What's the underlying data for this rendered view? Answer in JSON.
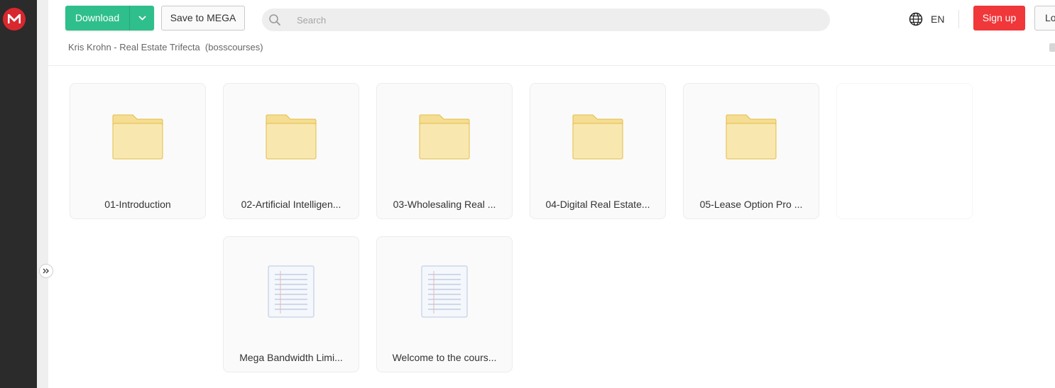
{
  "app": {
    "logo_icon": "mega-logo-icon",
    "accent": "#d9272e"
  },
  "toolbar": {
    "download_label": "Download",
    "save_label": "Save to MEGA",
    "download_color": "#2fbf8c"
  },
  "search": {
    "placeholder": "Search"
  },
  "language": {
    "label": "EN"
  },
  "auth": {
    "signup_label": "Sign up",
    "login_label": "Lo",
    "signup_color": "#f0373a"
  },
  "breadcrumb": {
    "folder": "Kris Krohn - Real Estate Trifecta",
    "owner": "(bosscourses)"
  },
  "items": [
    {
      "name": "01-Introduction",
      "type": "folder"
    },
    {
      "name": "02-Artificial Intelligen...",
      "type": "folder"
    },
    {
      "name": "03-Wholesaling Real ...",
      "type": "folder"
    },
    {
      "name": "04-Digital Real Estate...",
      "type": "folder"
    },
    {
      "name": "05-Lease Option Pro ...",
      "type": "folder"
    },
    {
      "name": "Mega Bandwidth Limi...",
      "type": "document"
    },
    {
      "name": "Welcome to the cours...",
      "type": "document"
    }
  ]
}
